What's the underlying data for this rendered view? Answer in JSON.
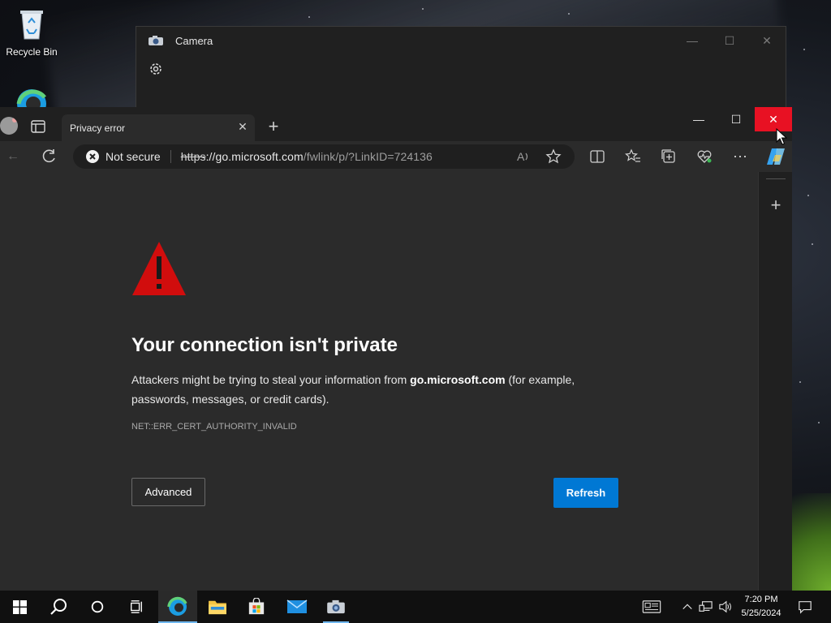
{
  "desktop": {
    "recycle_bin_label": "Recycle Bin"
  },
  "camera_window": {
    "title": "Camera"
  },
  "browser": {
    "tab_title": "Privacy error",
    "address": {
      "security_label": "Not secure",
      "url_scheme": "https",
      "url_domain": "://go.microsoft.com",
      "url_path": "/fwlink/p/?LinkID=724136"
    },
    "error_page": {
      "title": "Your connection isn't private",
      "desc_prefix": "Attackers might be trying to steal your information from ",
      "desc_domain": "go.microsoft.com",
      "desc_suffix": " (for example, passwords, messages, or credit cards).",
      "error_code": "NET::ERR_CERT_AUTHORITY_INVALID",
      "advanced_label": "Advanced",
      "refresh_label": "Refresh"
    }
  },
  "taskbar": {
    "time": "7:20 PM",
    "date": "5/25/2024"
  },
  "colors": {
    "close_red": "#e81123",
    "accent_blue": "#0078d4",
    "warning_red": "#d10d0d"
  }
}
